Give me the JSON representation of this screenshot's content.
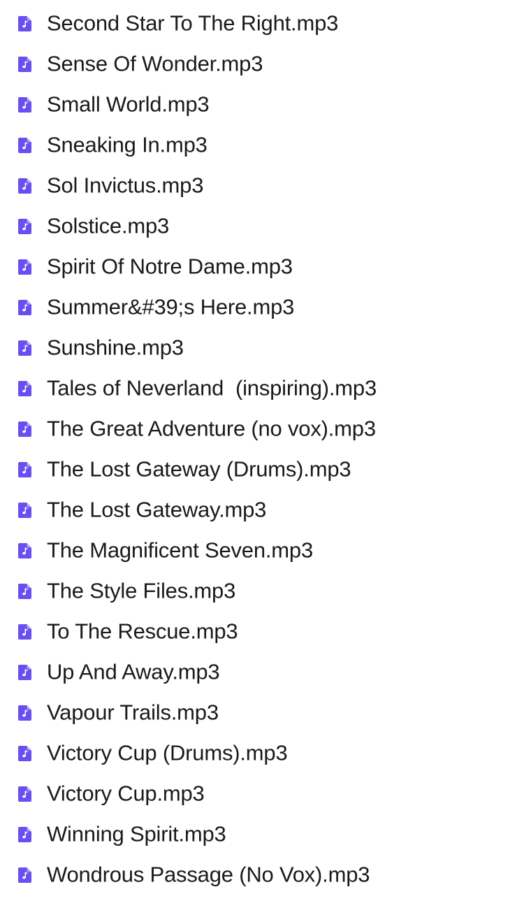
{
  "files": [
    {
      "name": "Second Star To The Right.mp3",
      "icon": "audio-file-icon"
    },
    {
      "name": "Sense Of Wonder.mp3",
      "icon": "audio-file-icon"
    },
    {
      "name": "Small World.mp3",
      "icon": "audio-file-icon"
    },
    {
      "name": "Sneaking In.mp3",
      "icon": "audio-file-icon"
    },
    {
      "name": "Sol Invictus.mp3",
      "icon": "audio-file-icon"
    },
    {
      "name": "Solstice.mp3",
      "icon": "audio-file-icon"
    },
    {
      "name": "Spirit Of Notre Dame.mp3",
      "icon": "audio-file-icon"
    },
    {
      "name": "Summer&#39;s Here.mp3",
      "icon": "audio-file-icon"
    },
    {
      "name": "Sunshine.mp3",
      "icon": "audio-file-icon"
    },
    {
      "name": "Tales of Neverland  (inspiring).mp3",
      "icon": "audio-file-icon"
    },
    {
      "name": "The Great Adventure (no vox).mp3",
      "icon": "audio-file-icon"
    },
    {
      "name": "The Lost Gateway (Drums).mp3",
      "icon": "audio-file-icon"
    },
    {
      "name": "The Lost Gateway.mp3",
      "icon": "audio-file-icon"
    },
    {
      "name": "The Magnificent Seven.mp3",
      "icon": "audio-file-icon"
    },
    {
      "name": "The Style Files.mp3",
      "icon": "audio-file-icon"
    },
    {
      "name": "To The Rescue.mp3",
      "icon": "audio-file-icon"
    },
    {
      "name": "Up And Away.mp3",
      "icon": "audio-file-icon"
    },
    {
      "name": "Vapour Trails.mp3",
      "icon": "audio-file-icon"
    },
    {
      "name": "Victory Cup (Drums).mp3",
      "icon": "audio-file-icon"
    },
    {
      "name": "Victory Cup.mp3",
      "icon": "audio-file-icon"
    },
    {
      "name": "Winning Spirit.mp3",
      "icon": "audio-file-icon"
    },
    {
      "name": "Wondrous Passage (No Vox).mp3",
      "icon": "audio-file-icon"
    }
  ],
  "colors": {
    "icon": "#6b4ef0",
    "text": "#1a1a1a"
  }
}
